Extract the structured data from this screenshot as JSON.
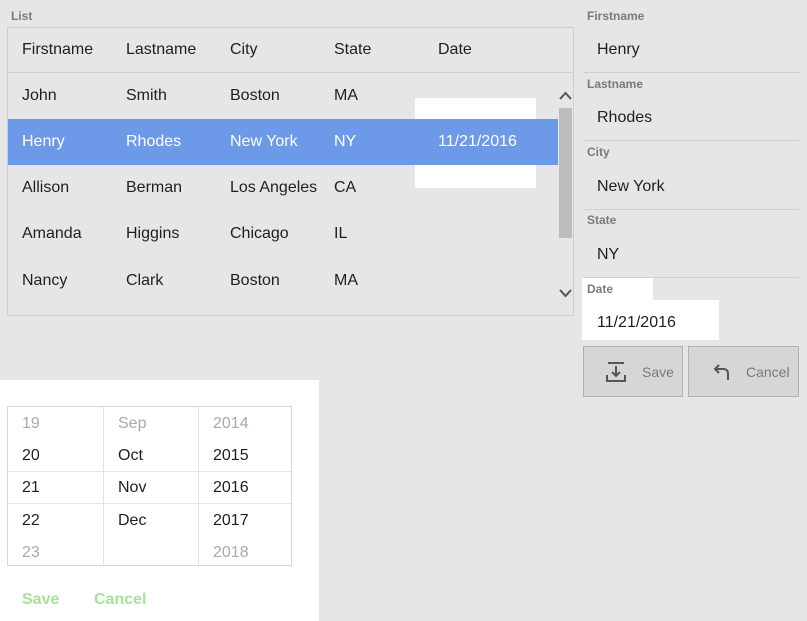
{
  "list": {
    "label": "List",
    "columns": [
      "Firstname",
      "Lastname",
      "City",
      "State",
      "Date"
    ],
    "rows": [
      {
        "firstname": "John",
        "lastname": "Smith",
        "city": "Boston",
        "state": "MA",
        "date": ""
      },
      {
        "firstname": "Henry",
        "lastname": "Rhodes",
        "city": "New York",
        "state": "NY",
        "date": "11/21/2016"
      },
      {
        "firstname": "Allison",
        "lastname": "Berman",
        "city": "Los Angeles",
        "state": "CA",
        "date": ""
      },
      {
        "firstname": "Amanda",
        "lastname": "Higgins",
        "city": "Chicago",
        "state": "IL",
        "date": ""
      },
      {
        "firstname": "Nancy",
        "lastname": "Clark",
        "city": "Boston",
        "state": "MA",
        "date": ""
      }
    ],
    "selected_row": 1
  },
  "form": {
    "firstname_label": "Firstname",
    "firstname_value": "Henry",
    "lastname_label": "Lastname",
    "lastname_value": "Rhodes",
    "city_label": "City",
    "city_value": "New York",
    "state_label": "State",
    "state_value": "NY",
    "date_label": "Date",
    "date_value": "11/21/2016",
    "save_label": "Save",
    "cancel_label": "Cancel"
  },
  "picker": {
    "days": [
      "19",
      "20",
      "21",
      "22",
      "23"
    ],
    "months": [
      "Sep",
      "Oct",
      "Nov",
      "Dec",
      ""
    ],
    "years": [
      "2014",
      "2015",
      "2016",
      "2017",
      "2018"
    ],
    "save_label": "Save",
    "cancel_label": "Cancel"
  },
  "icons": {
    "scroll_up": "chevron-up-icon",
    "scroll_down": "chevron-down-icon",
    "save": "download-tray-icon",
    "cancel": "undo-arrow-icon"
  },
  "colors": {
    "selection": "#6d9ae8",
    "picker_buttons": "#a6e39a"
  }
}
